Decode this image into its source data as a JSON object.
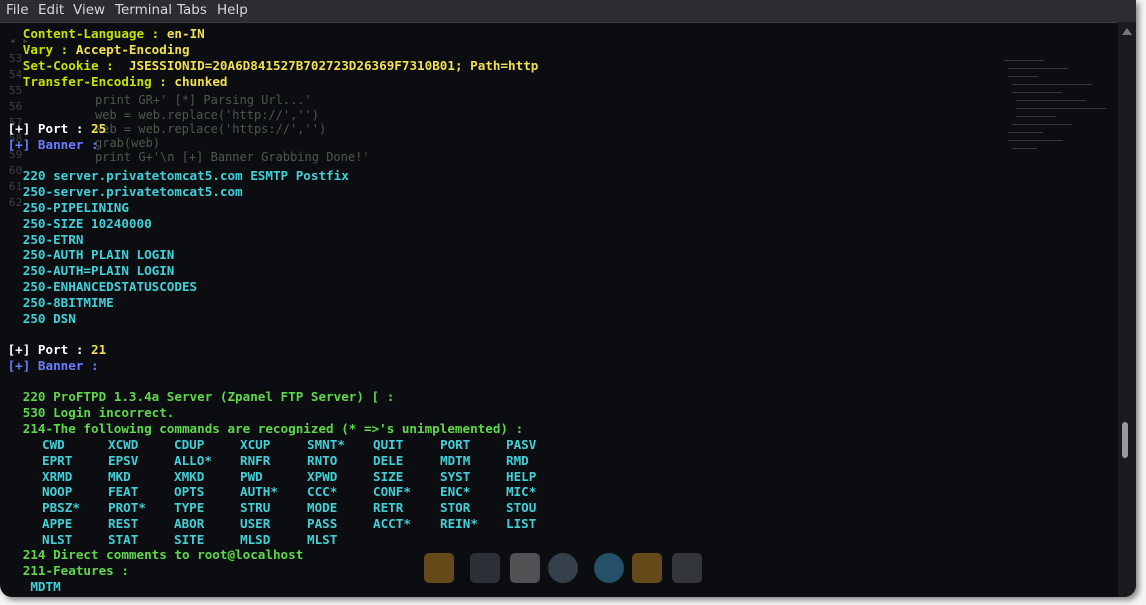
{
  "menu": [
    "File",
    "Edit",
    "View",
    "Terminal",
    "Tabs",
    "Help"
  ],
  "header_lines": [
    {
      "key": "Content-Language :",
      "value": "en-IN"
    },
    {
      "key": "Vary :",
      "value": "Accept-Encoding"
    },
    {
      "key": "Set-Cookie :",
      "value": "JSESSIONID=20A6D841527B702723D26369F7310B01; Path=http"
    },
    {
      "key": "Transfer-Encoding :",
      "value": "chunked"
    }
  ],
  "port1": {
    "label": "[+] Port :",
    "value": "25"
  },
  "banner1_label": "[+] Banner :",
  "smtp_lines": [
    "220 server.privatetomcat5.com ESMTP Postfix",
    "250-server.privatetomcat5.com",
    "250-PIPELINING",
    "250-SIZE 10240000",
    "250-ETRN",
    "250-AUTH PLAIN LOGIN",
    "250-AUTH=PLAIN LOGIN",
    "250-ENHANCEDSTATUSCODES",
    "250-8BITMIME",
    "250 DSN"
  ],
  "port2": {
    "label": "[+] Port :",
    "value": "21"
  },
  "banner2_label": "[+] Banner :",
  "ftp_lines": [
    "220 ProFTPD 1.3.4a Server (Zpanel FTP Server) [ :",
    "530 Login incorrect.",
    "214-The following commands are recognized (* =>'s unimplemented) :"
  ],
  "ftp_commands": [
    [
      "CWD",
      "XCWD",
      "CDUP",
      "XCUP",
      "SMNT*",
      "QUIT",
      "PORT",
      "PASV"
    ],
    [
      "EPRT",
      "EPSV",
      "ALLO*",
      "RNFR",
      "RNTO",
      "DELE",
      "MDTM",
      "RMD"
    ],
    [
      "XRMD",
      "MKD",
      "XMKD",
      "PWD",
      "XPWD",
      "SIZE",
      "SYST",
      "HELP"
    ],
    [
      "NOOP",
      "FEAT",
      "OPTS",
      "AUTH*",
      "CCC*",
      "CONF*",
      "ENC*",
      "MIC*"
    ],
    [
      "PBSZ*",
      "PROT*",
      "TYPE",
      "STRU",
      "MODE",
      "RETR",
      "STOR",
      "STOU"
    ],
    [
      "APPE",
      "REST",
      "ABOR",
      "USER",
      "PASS",
      "ACCT*",
      "REIN*",
      "LIST"
    ],
    [
      "NLST",
      "STAT",
      "SITE",
      "MLSD",
      "MLST"
    ]
  ],
  "ftp_footer_lines": [
    "214 Direct comments to root@localhost",
    "211-Features :",
    "MDTM"
  ],
  "colors": {
    "header_key": "#c8e000",
    "value": "#f0e050",
    "banner": "#6b7cff",
    "smtp": "#41d0d8",
    "ftp": "#5ed84a"
  }
}
